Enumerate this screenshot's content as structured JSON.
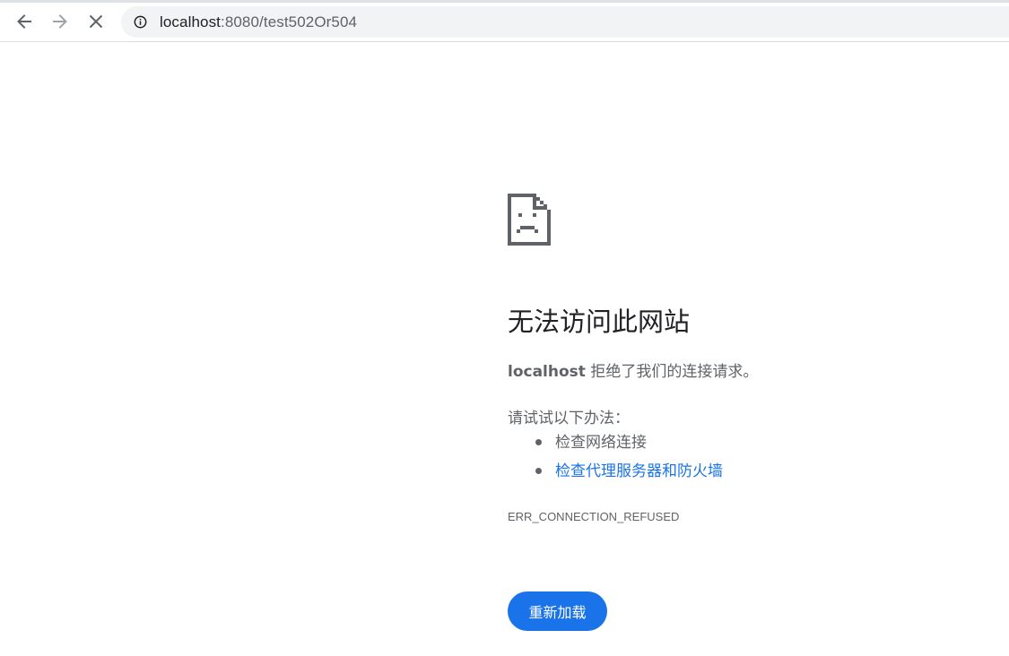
{
  "browser": {
    "url_host": "localhost",
    "url_rest": ":8080/test502Or504",
    "icons": {
      "back": "arrow-left-icon",
      "forward": "arrow-right-icon",
      "stop": "close-icon",
      "site_info": "info-circle-icon"
    }
  },
  "error_page": {
    "icon": "sad-page-icon",
    "title": "无法访问此网站",
    "summary_host": "localhost",
    "summary_text": " 拒绝了我们的连接请求。",
    "try_heading": "请试试以下办法：",
    "suggestions": [
      {
        "text": "检查网络连接",
        "is_link": false
      },
      {
        "text": "检查代理服务器和防火墙",
        "is_link": true
      }
    ],
    "error_code": "ERR_CONNECTION_REFUSED",
    "reload_label": "重新加载"
  },
  "colors": {
    "accent": "#1a73e8",
    "text_primary": "#202124",
    "text_secondary": "#5f6368",
    "omnibox_bg": "#f1f3f4"
  }
}
